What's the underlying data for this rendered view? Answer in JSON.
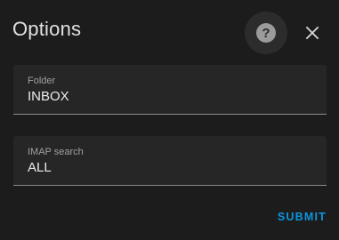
{
  "dialog": {
    "title": "Options",
    "help_icon": "help-circle-icon",
    "close_icon": "close-icon"
  },
  "fields": {
    "folder": {
      "label": "Folder",
      "value": "INBOX"
    },
    "imap_search": {
      "label": "IMAP search",
      "value": "ALL"
    }
  },
  "actions": {
    "submit_label": "SUBMIT"
  },
  "colors": {
    "background": "#1c1c1c",
    "field_background": "#262626",
    "accent": "#0b96e0",
    "text": "#e1e1e1",
    "muted_text": "#a0a0a0"
  }
}
